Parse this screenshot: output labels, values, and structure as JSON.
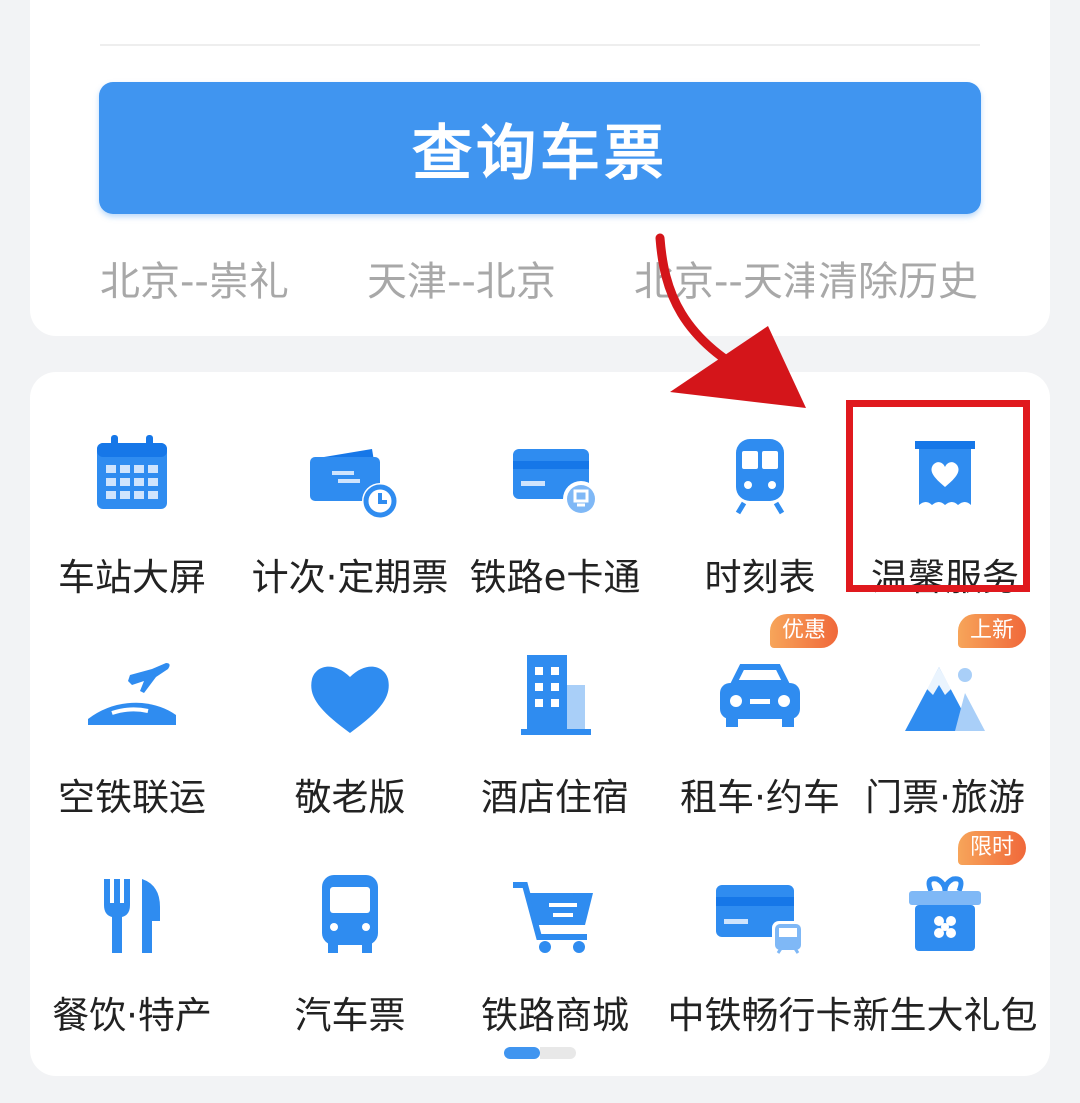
{
  "query_button": {
    "label": "查询车票"
  },
  "history": {
    "items": [
      "北京--崇礼",
      "天津--北京",
      "北京--天津"
    ],
    "clear_label": "清除历史"
  },
  "services": [
    {
      "label": "车站大屏",
      "icon": "calendar-icon"
    },
    {
      "label": "计次·定期票",
      "icon": "ticket-clock-icon"
    },
    {
      "label": "铁路e卡通",
      "icon": "rail-card-icon"
    },
    {
      "label": "时刻表",
      "icon": "train-front-icon"
    },
    {
      "label": "温馨服务",
      "icon": "heart-banner-icon"
    },
    {
      "label": "空铁联运",
      "icon": "plane-train-icon"
    },
    {
      "label": "敬老版",
      "icon": "heart-icon"
    },
    {
      "label": "酒店住宿",
      "icon": "hotel-building-icon"
    },
    {
      "label": "租车·约车",
      "icon": "car-icon",
      "badge": "优惠"
    },
    {
      "label": "门票·旅游",
      "icon": "mountain-icon",
      "badge": "上新"
    },
    {
      "label": "餐饮·特产",
      "icon": "fork-knife-icon"
    },
    {
      "label": "汽车票",
      "icon": "bus-icon"
    },
    {
      "label": "铁路商城",
      "icon": "shopping-cart-icon"
    },
    {
      "label": "中铁畅行卡",
      "icon": "card-train-icon"
    },
    {
      "label": "新生大礼包",
      "icon": "gift-box-icon",
      "badge": "限时"
    }
  ],
  "pagination": {
    "current": 1,
    "total": 2
  },
  "colors": {
    "primary": "#4095f0",
    "highlight": "#e0191e",
    "badge": "#f0683a"
  }
}
